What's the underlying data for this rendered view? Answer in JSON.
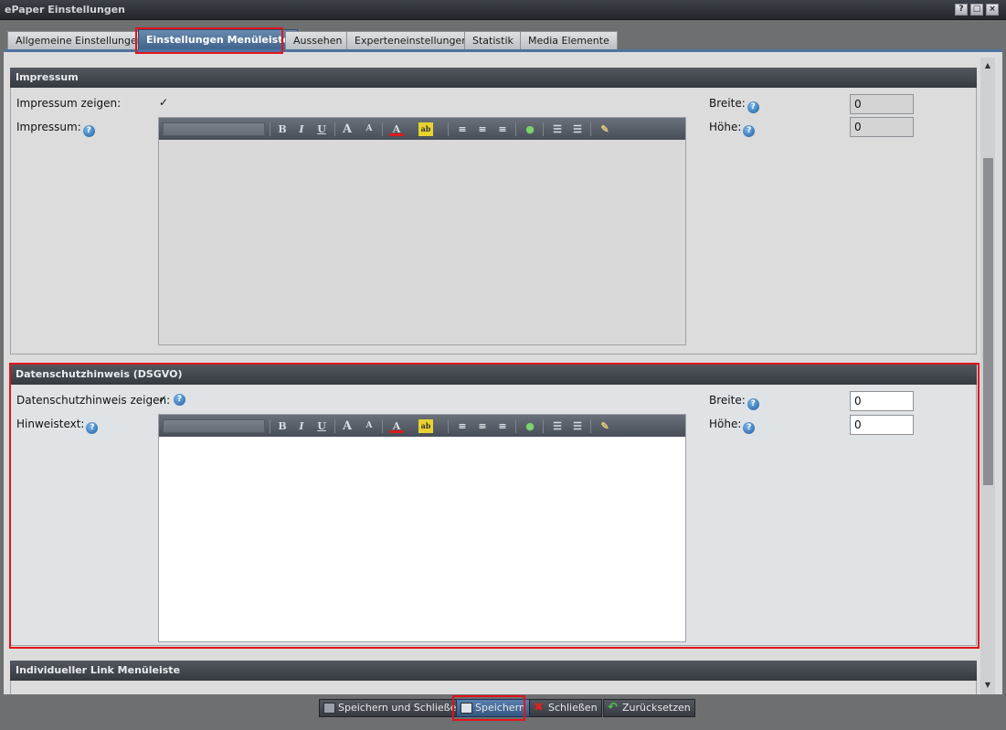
{
  "window": {
    "title": "ePaper Einstellungen",
    "controls": [
      "?",
      "□",
      "×"
    ]
  },
  "tabs": [
    {
      "label": "Allgemeine Einstellungen",
      "active": false
    },
    {
      "label": "Einstellungen Menüleiste",
      "active": true
    },
    {
      "label": "Aussehen",
      "active": false
    },
    {
      "label": "Experteneinstellungen",
      "active": false
    },
    {
      "label": "Statistik",
      "active": false
    },
    {
      "label": "Media Elemente",
      "active": false
    }
  ],
  "impressum": {
    "header": "Impressum",
    "show_label": "Impressum zeigen:",
    "show_checked": true,
    "text_label": "Impressum:",
    "width_label": "Breite:",
    "width_value": "0",
    "height_label": "Höhe:",
    "height_value": "0"
  },
  "datenschutz": {
    "header": "Datenschutzhinweis (DSGVO)",
    "show_label": "Datenschutzhinweis zeigen:",
    "show_checked": true,
    "text_label": "Hinweistext:",
    "width_label": "Breite:",
    "width_value": "0",
    "height_label": "Höhe:",
    "height_value": "0"
  },
  "link_section": {
    "header": "Individueller Link Menüleiste"
  },
  "editor_toolbar": {
    "buttons": [
      "bold-icon",
      "italic-icon",
      "underline-icon",
      "font-grow-icon",
      "font-shrink-icon",
      "font-color-icon",
      "highlight-icon",
      "align-left-icon",
      "align-center-icon",
      "align-right-icon",
      "link-icon",
      "bullet-list-icon",
      "numbered-list-icon",
      "source-edit-icon"
    ]
  },
  "footer": {
    "save_close": "Speichern und Schließen",
    "save": "Speichern",
    "close": "Schließen",
    "reset": "Zurücksetzen"
  },
  "colors": {
    "highlight": "#e0141c",
    "active_tab": "#3c5f88",
    "panel_header": "#353a41"
  }
}
